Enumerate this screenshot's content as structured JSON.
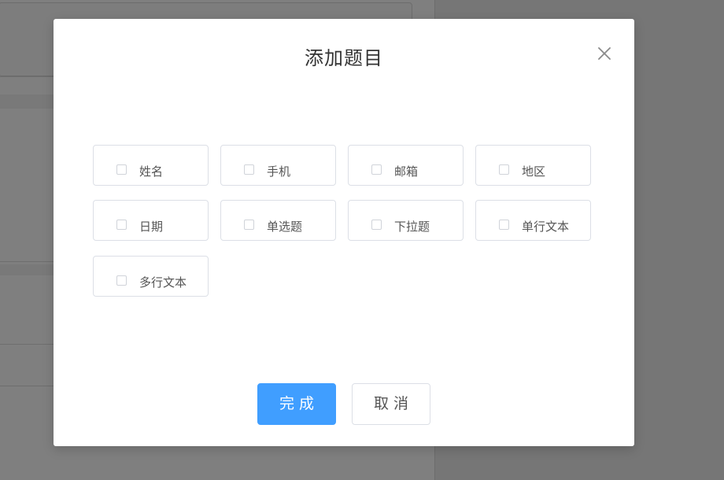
{
  "dialog": {
    "title": "添加题目",
    "close_icon": "close-icon",
    "options": [
      {
        "label": "姓名",
        "checked": false
      },
      {
        "label": "手机",
        "checked": false
      },
      {
        "label": "邮箱",
        "checked": false
      },
      {
        "label": "地区",
        "checked": false
      },
      {
        "label": "日期",
        "checked": false
      },
      {
        "label": "单选题",
        "checked": false
      },
      {
        "label": "下拉题",
        "checked": false
      },
      {
        "label": "单行文本",
        "checked": false
      },
      {
        "label": "多行文本",
        "checked": false
      }
    ],
    "confirm_label": "完成",
    "cancel_label": "取消"
  },
  "colors": {
    "primary": "#409eff",
    "overlay": "rgba(0,0,0,0.5)",
    "border": "#dcdfe6",
    "text": "#555555"
  }
}
